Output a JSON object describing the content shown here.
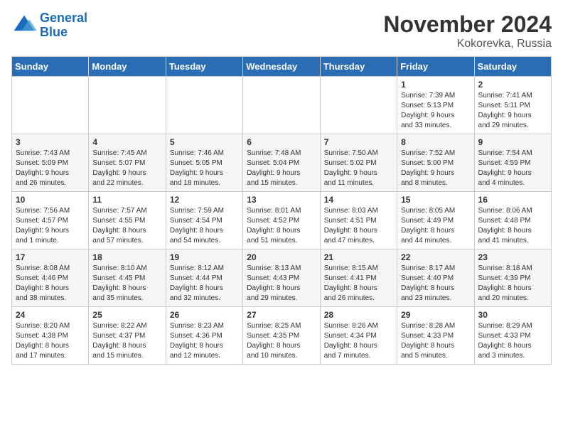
{
  "logo": {
    "line1": "General",
    "line2": "Blue"
  },
  "title": "November 2024",
  "location": "Kokorevka, Russia",
  "weekdays": [
    "Sunday",
    "Monday",
    "Tuesday",
    "Wednesday",
    "Thursday",
    "Friday",
    "Saturday"
  ],
  "weeks": [
    [
      {
        "day": "",
        "info": ""
      },
      {
        "day": "",
        "info": ""
      },
      {
        "day": "",
        "info": ""
      },
      {
        "day": "",
        "info": ""
      },
      {
        "day": "",
        "info": ""
      },
      {
        "day": "1",
        "info": "Sunrise: 7:39 AM\nSunset: 5:13 PM\nDaylight: 9 hours\nand 33 minutes."
      },
      {
        "day": "2",
        "info": "Sunrise: 7:41 AM\nSunset: 5:11 PM\nDaylight: 9 hours\nand 29 minutes."
      }
    ],
    [
      {
        "day": "3",
        "info": "Sunrise: 7:43 AM\nSunset: 5:09 PM\nDaylight: 9 hours\nand 26 minutes."
      },
      {
        "day": "4",
        "info": "Sunrise: 7:45 AM\nSunset: 5:07 PM\nDaylight: 9 hours\nand 22 minutes."
      },
      {
        "day": "5",
        "info": "Sunrise: 7:46 AM\nSunset: 5:05 PM\nDaylight: 9 hours\nand 18 minutes."
      },
      {
        "day": "6",
        "info": "Sunrise: 7:48 AM\nSunset: 5:04 PM\nDaylight: 9 hours\nand 15 minutes."
      },
      {
        "day": "7",
        "info": "Sunrise: 7:50 AM\nSunset: 5:02 PM\nDaylight: 9 hours\nand 11 minutes."
      },
      {
        "day": "8",
        "info": "Sunrise: 7:52 AM\nSunset: 5:00 PM\nDaylight: 9 hours\nand 8 minutes."
      },
      {
        "day": "9",
        "info": "Sunrise: 7:54 AM\nSunset: 4:59 PM\nDaylight: 9 hours\nand 4 minutes."
      }
    ],
    [
      {
        "day": "10",
        "info": "Sunrise: 7:56 AM\nSunset: 4:57 PM\nDaylight: 9 hours\nand 1 minute."
      },
      {
        "day": "11",
        "info": "Sunrise: 7:57 AM\nSunset: 4:55 PM\nDaylight: 8 hours\nand 57 minutes."
      },
      {
        "day": "12",
        "info": "Sunrise: 7:59 AM\nSunset: 4:54 PM\nDaylight: 8 hours\nand 54 minutes."
      },
      {
        "day": "13",
        "info": "Sunrise: 8:01 AM\nSunset: 4:52 PM\nDaylight: 8 hours\nand 51 minutes."
      },
      {
        "day": "14",
        "info": "Sunrise: 8:03 AM\nSunset: 4:51 PM\nDaylight: 8 hours\nand 47 minutes."
      },
      {
        "day": "15",
        "info": "Sunrise: 8:05 AM\nSunset: 4:49 PM\nDaylight: 8 hours\nand 44 minutes."
      },
      {
        "day": "16",
        "info": "Sunrise: 8:06 AM\nSunset: 4:48 PM\nDaylight: 8 hours\nand 41 minutes."
      }
    ],
    [
      {
        "day": "17",
        "info": "Sunrise: 8:08 AM\nSunset: 4:46 PM\nDaylight: 8 hours\nand 38 minutes."
      },
      {
        "day": "18",
        "info": "Sunrise: 8:10 AM\nSunset: 4:45 PM\nDaylight: 8 hours\nand 35 minutes."
      },
      {
        "day": "19",
        "info": "Sunrise: 8:12 AM\nSunset: 4:44 PM\nDaylight: 8 hours\nand 32 minutes."
      },
      {
        "day": "20",
        "info": "Sunrise: 8:13 AM\nSunset: 4:43 PM\nDaylight: 8 hours\nand 29 minutes."
      },
      {
        "day": "21",
        "info": "Sunrise: 8:15 AM\nSunset: 4:41 PM\nDaylight: 8 hours\nand 26 minutes."
      },
      {
        "day": "22",
        "info": "Sunrise: 8:17 AM\nSunset: 4:40 PM\nDaylight: 8 hours\nand 23 minutes."
      },
      {
        "day": "23",
        "info": "Sunrise: 8:18 AM\nSunset: 4:39 PM\nDaylight: 8 hours\nand 20 minutes."
      }
    ],
    [
      {
        "day": "24",
        "info": "Sunrise: 8:20 AM\nSunset: 4:38 PM\nDaylight: 8 hours\nand 17 minutes."
      },
      {
        "day": "25",
        "info": "Sunrise: 8:22 AM\nSunset: 4:37 PM\nDaylight: 8 hours\nand 15 minutes."
      },
      {
        "day": "26",
        "info": "Sunrise: 8:23 AM\nSunset: 4:36 PM\nDaylight: 8 hours\nand 12 minutes."
      },
      {
        "day": "27",
        "info": "Sunrise: 8:25 AM\nSunset: 4:35 PM\nDaylight: 8 hours\nand 10 minutes."
      },
      {
        "day": "28",
        "info": "Sunrise: 8:26 AM\nSunset: 4:34 PM\nDaylight: 8 hours\nand 7 minutes."
      },
      {
        "day": "29",
        "info": "Sunrise: 8:28 AM\nSunset: 4:33 PM\nDaylight: 8 hours\nand 5 minutes."
      },
      {
        "day": "30",
        "info": "Sunrise: 8:29 AM\nSunset: 4:33 PM\nDaylight: 8 hours\nand 3 minutes."
      }
    ]
  ]
}
